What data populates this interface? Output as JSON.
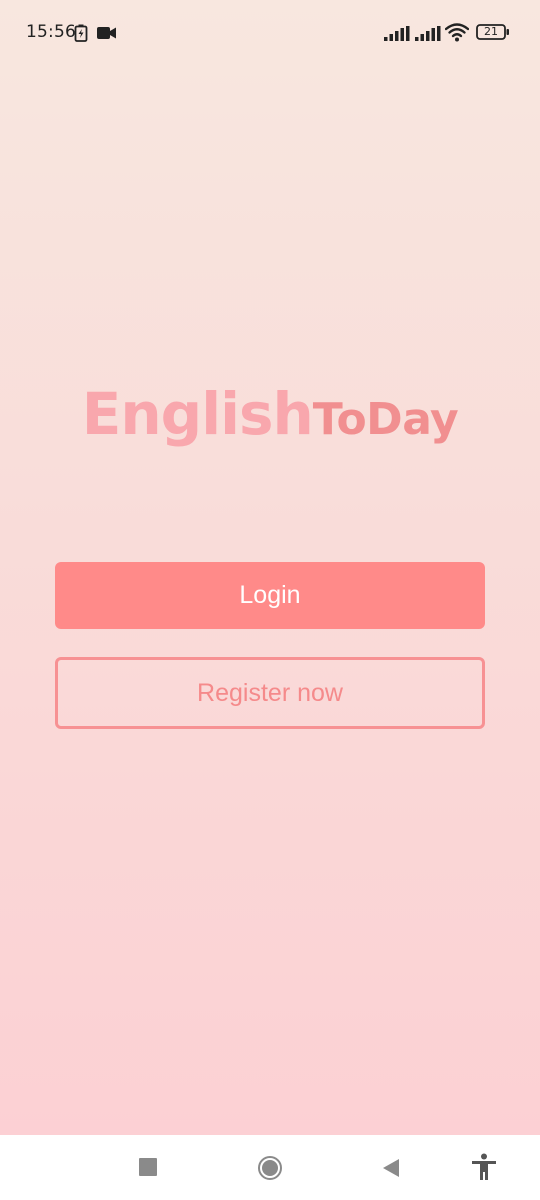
{
  "status_bar": {
    "time": "15:56",
    "battery_level": "21",
    "icons": [
      "battery-charge-icon",
      "camera-icon",
      "signal-icon",
      "signal-icon",
      "wifi-icon",
      "battery-icon"
    ]
  },
  "logo": {
    "part_1": "English",
    "part_2": "ToDay"
  },
  "actions": {
    "login_label": "Login",
    "register_label": "Register now"
  },
  "nav_bar": {
    "icons": [
      "recents-icon",
      "home-icon",
      "back-icon",
      "accessibility-icon"
    ]
  },
  "colors": {
    "primary": "#ff8a89",
    "logo_light": "#f9a7ad",
    "logo_dark": "#f18f90",
    "background_top": "#f8e7df",
    "background_bottom": "#fccfd3"
  }
}
